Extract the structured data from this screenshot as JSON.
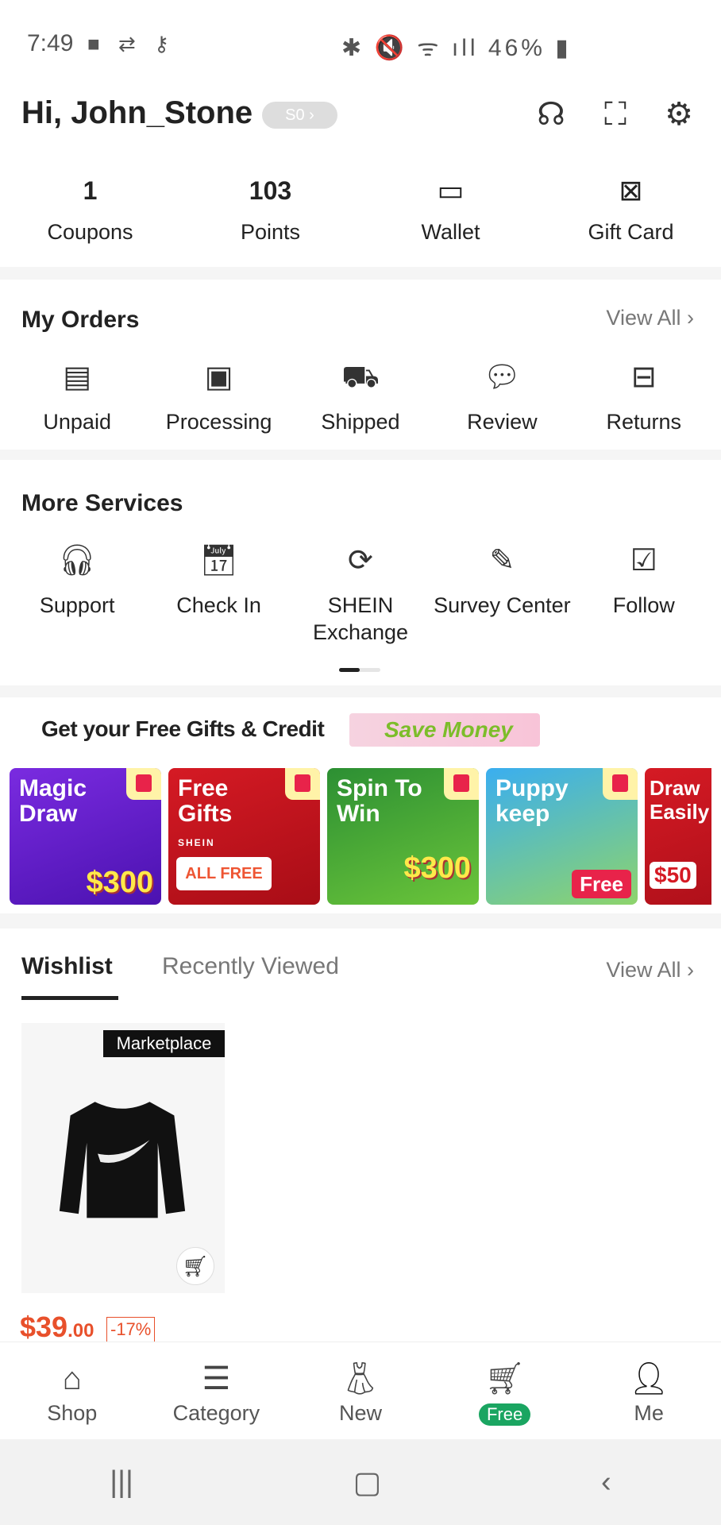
{
  "status_bar": {
    "time": "7:49",
    "left_icons": "video-icon sync-icon key-icon",
    "battery": "46%"
  },
  "header": {
    "greeting": "Hi, John_Stone",
    "level_badge": "S0 ›",
    "icons": [
      "support-bot-icon",
      "scan-icon",
      "settings-icon"
    ]
  },
  "stats": [
    {
      "value": "1",
      "label": "Coupons"
    },
    {
      "value": "103",
      "label": "Points"
    },
    {
      "icon": "wallet-icon",
      "label": "Wallet"
    },
    {
      "icon": "gift-card-icon",
      "label": "Gift Card"
    }
  ],
  "orders": {
    "title": "My Orders",
    "view_all": "View All",
    "items": [
      {
        "label": "Unpaid",
        "icon": "wallet-card-icon"
      },
      {
        "label": "Processing",
        "icon": "box-icon"
      },
      {
        "label": "Shipped",
        "icon": "truck-icon"
      },
      {
        "label": "Review",
        "icon": "chat-icon"
      },
      {
        "label": "Returns",
        "icon": "return-box-icon"
      }
    ]
  },
  "services": {
    "title": "More Services",
    "items": [
      {
        "label": "Support",
        "icon": "headset-icon"
      },
      {
        "label": "Check In",
        "icon": "calendar-check-icon"
      },
      {
        "label": "SHEIN Exchange",
        "icon": "exchange-icon"
      },
      {
        "label": "Survey Center",
        "icon": "survey-icon"
      },
      {
        "label": "Follow",
        "icon": "checkbox-icon"
      }
    ]
  },
  "gifts": {
    "title": "Get your Free Gifts & Credit",
    "save": "Save Money",
    "cards": [
      {
        "title": "Magic Draw",
        "badge": "$300",
        "color": "#6a1fd0"
      },
      {
        "title": "Free Gifts",
        "brand": "SHEIN",
        "badge": "ALL FREE",
        "color": "#c8101e"
      },
      {
        "title": "Spin To Win",
        "badge": "$300",
        "color": "#2e9a3a"
      },
      {
        "title": "Puppy keep",
        "badge": "Free",
        "color": "#3fb2ea"
      },
      {
        "title": "Draw Easily",
        "badge": "$50",
        "color": "#c8101e"
      }
    ]
  },
  "tabs": {
    "wishlist": "Wishlist",
    "recent": "Recently Viewed",
    "view_all": "View All"
  },
  "product": {
    "tag": "Marketplace",
    "price_main": "$39",
    "price_cents": ".00",
    "discount": "-17%"
  },
  "bottom_nav": [
    {
      "label": "Shop",
      "icon": "home-icon"
    },
    {
      "label": "Category",
      "icon": "category-search-icon"
    },
    {
      "label": "New",
      "icon": "dress-icon"
    },
    {
      "label": "Free",
      "icon": "cart-icon"
    },
    {
      "label": "Me",
      "icon": "person-icon"
    }
  ]
}
